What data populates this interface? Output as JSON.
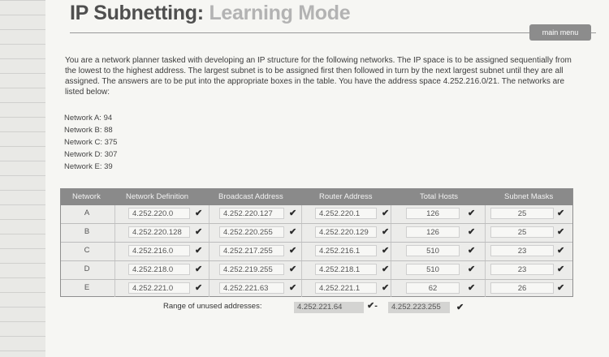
{
  "header": {
    "title_main": "IP Subnetting:",
    "title_sub": "Learning Mode",
    "menu_button": "main menu"
  },
  "intro": "You are a network planner tasked with developing an IP structure for the following networks. The IP space is to be assigned sequentially from the lowest to the highest address. The largest subnet is to be assigned first then followed in turn by the next largest subnet until they are all assigned. The answers are to be put into the appropriate boxes in the table. You have the address space 4.252.216.0/21. The networks are listed below:",
  "networks": [
    "Network A: 94",
    "Network B: 88",
    "Network C: 375",
    "Network D: 307",
    "Network E: 39"
  ],
  "table": {
    "headers": [
      "Network",
      "Network Definition",
      "Broadcast Address",
      "Router Address",
      "Total Hosts",
      "Subnet Masks"
    ],
    "rows": [
      {
        "label": "A",
        "definition": "4.252.220.0",
        "broadcast": "4.252.220.127",
        "router": "4.252.220.1",
        "hosts": "126",
        "mask": "25"
      },
      {
        "label": "B",
        "definition": "4.252.220.128",
        "broadcast": "4.252.220.255",
        "router": "4.252.220.129",
        "hosts": "126",
        "mask": "25"
      },
      {
        "label": "C",
        "definition": "4.252.216.0",
        "broadcast": "4.252.217.255",
        "router": "4.252.216.1",
        "hosts": "510",
        "mask": "23"
      },
      {
        "label": "D",
        "definition": "4.252.218.0",
        "broadcast": "4.252.219.255",
        "router": "4.252.218.1",
        "hosts": "510",
        "mask": "23"
      },
      {
        "label": "E",
        "definition": "4.252.221.0",
        "broadcast": "4.252.221.63",
        "router": "4.252.221.1",
        "hosts": "62",
        "mask": "26"
      }
    ],
    "check": "✔"
  },
  "unused": {
    "label": "Range of unused addresses:",
    "start": "4.252.221.64",
    "end": "4.252.223.255",
    "separator": "-"
  }
}
